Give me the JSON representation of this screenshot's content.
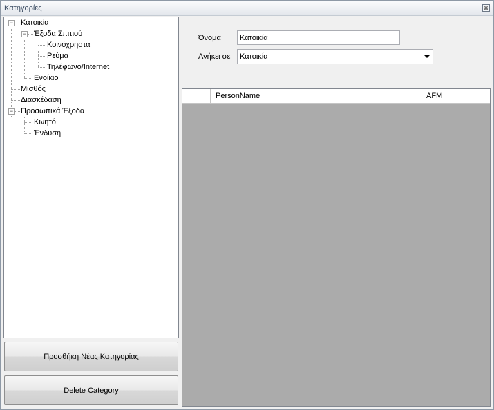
{
  "window": {
    "title": "Κατηγορίες",
    "close_glyph": "⊠"
  },
  "tree": {
    "toggle_collapse": "−",
    "nodes": [
      {
        "label": "Κατοικία"
      },
      {
        "label": "Έξοδα Σπιτιού"
      },
      {
        "label": "Κοινόχρηστα"
      },
      {
        "label": "Ρεύμα"
      },
      {
        "label": "Τηλέφωνο/Internet"
      },
      {
        "label": "Ενοίκιο"
      },
      {
        "label": "Μισθός"
      },
      {
        "label": "Διασκέδαση"
      },
      {
        "label": "Προσωπικά Έξοδα"
      },
      {
        "label": "Κινητό"
      },
      {
        "label": "Ένδυση"
      }
    ]
  },
  "buttons": {
    "add_label": "Προσθήκη Νέας Κατηγορίας",
    "delete_label": "Delete Category"
  },
  "form": {
    "name_label": "Όνομα",
    "name_value": "Κατοικία",
    "belongs_label": "Ανήκει σε",
    "belongs_value": "Κατοικία"
  },
  "grid": {
    "columns": [
      "",
      "PersonName",
      "AFM"
    ],
    "rows": []
  },
  "icons": {
    "close": "close-icon",
    "collapse": "minus-toggle-icon",
    "dropdown": "chevron-down-icon"
  }
}
